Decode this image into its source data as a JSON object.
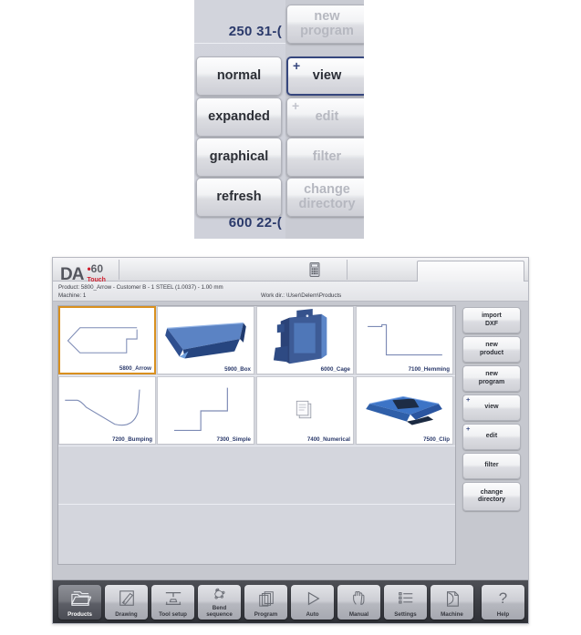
{
  "inset": {
    "list_rows": [
      {
        "text": "250 31-("
      },
      {
        "text": "600 22-("
      }
    ],
    "left_buttons": [
      {
        "label": "normal",
        "name": "normal-button"
      },
      {
        "label": "expanded",
        "name": "expanded-button"
      },
      {
        "label": "graphical",
        "name": "graphical-button"
      },
      {
        "label": "refresh",
        "name": "refresh-button"
      }
    ],
    "right_buttons": [
      {
        "label": "new\nprogram",
        "name": "new-program-button",
        "plus": false,
        "selected": false
      },
      {
        "label": "view",
        "name": "view-button",
        "plus": true,
        "selected": true
      },
      {
        "label": "edit",
        "name": "edit-button",
        "plus": true,
        "selected": false
      },
      {
        "label": "filter",
        "name": "filter-button",
        "plus": false,
        "selected": false
      },
      {
        "label": "change\ndirectory",
        "name": "change-directory-button",
        "plus": false,
        "selected": false
      }
    ],
    "accent_selected": "#36477e"
  },
  "shot": {
    "header": {
      "logo_da": "DA",
      "logo_dot": "•",
      "logo_60": "60",
      "logo_touch": "Touch",
      "calculator_icon": "calculator-icon",
      "unlock_icon": "unlock-icon"
    },
    "info": {
      "product_line": "Product: 5800_Arrow - Customer B - 1 STEEL (1.0037) - 1.00 mm",
      "machine_line": "Machine: 1",
      "workdir_line": "Work dir.: \\User\\Delem\\Products"
    },
    "products": [
      {
        "label": "5800_Arrow",
        "thumb": "arrow-profile-2d",
        "selected": true
      },
      {
        "label": "5900_Box",
        "thumb": "box-3d",
        "selected": false
      },
      {
        "label": "6000_Cage",
        "thumb": "cage-3d",
        "selected": false
      },
      {
        "label": "7100_Hemming",
        "thumb": "hemming-profile-2d",
        "selected": false
      },
      {
        "label": "7200_Bumping",
        "thumb": "bumping-profile-2d",
        "selected": false
      },
      {
        "label": "7300_Simple",
        "thumb": "simple-profile-2d",
        "selected": false
      },
      {
        "label": "7400_Numerical",
        "thumb": "numerical-doc-icon",
        "selected": false
      },
      {
        "label": "7500_Clip",
        "thumb": "clip-3d",
        "selected": false
      }
    ],
    "side_buttons": [
      {
        "label": "import\nDXF",
        "name": "import-dxf-button",
        "plus": false
      },
      {
        "label": "new\nproduct",
        "name": "new-product-button",
        "plus": false
      },
      {
        "label": "new\nprogram",
        "name": "new-program-button",
        "plus": false
      },
      {
        "label": "view",
        "name": "view-button",
        "plus": true
      },
      {
        "label": "edit",
        "name": "edit-button",
        "plus": true
      },
      {
        "label": "filter",
        "name": "filter-button",
        "plus": false
      },
      {
        "label": "change\ndirectory",
        "name": "change-directory-button",
        "plus": false
      }
    ],
    "toolbar": [
      {
        "label": "Products",
        "icon": "folder-icon",
        "active": true
      },
      {
        "label": "Drawing",
        "icon": "pencil-icon",
        "active": false
      },
      {
        "label": "Tool setup",
        "icon": "tool-press-icon",
        "active": false
      },
      {
        "label": "Bend\nsequence",
        "icon": "bend-sequence-icon",
        "active": false
      },
      {
        "label": "Program",
        "icon": "pages-icon",
        "active": false
      },
      {
        "label": "Auto",
        "icon": "play-triangle-icon",
        "active": false
      },
      {
        "label": "Manual",
        "icon": "hand-icon",
        "active": false
      },
      {
        "label": "Settings",
        "icon": "list-icon",
        "active": false
      },
      {
        "label": "Machine",
        "icon": "machine-page-icon",
        "active": false
      },
      {
        "label": "Help",
        "icon": "question-mark-icon",
        "active": false
      }
    ],
    "colors": {
      "selection_orange": "#d9901f",
      "label_blue": "#2b3a6b",
      "logo_red": "#cf1f2e",
      "toolbar_dark": "#3d3f45"
    }
  }
}
